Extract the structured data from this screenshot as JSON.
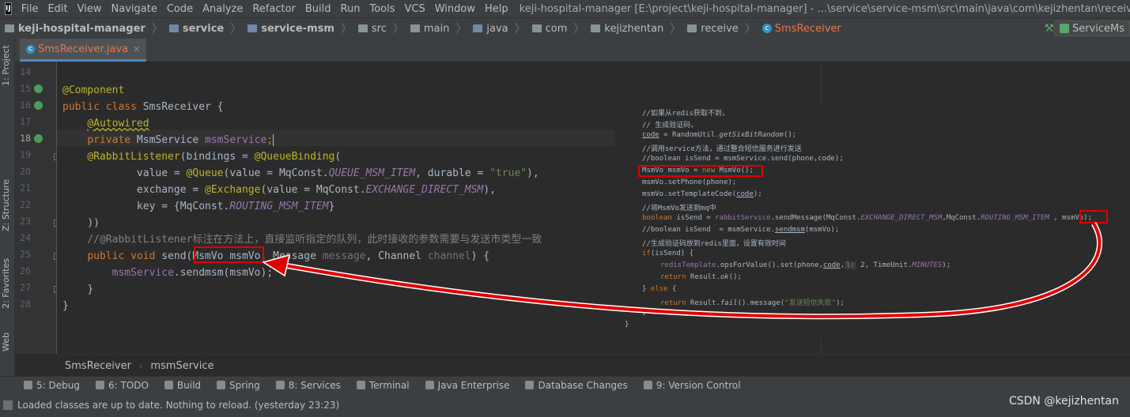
{
  "menubar": {
    "items": [
      "File",
      "Edit",
      "View",
      "Navigate",
      "Code",
      "Analyze",
      "Refactor",
      "Build",
      "Run",
      "Tools",
      "VCS",
      "Window",
      "Help"
    ],
    "window_title": "keji-hospital-manager [E:\\project\\keji-hospital-manager] - ...\\service\\service-msm\\src\\main\\java\\com\\kejizhentan\\receive\\SmsReceiver.java"
  },
  "navbar": {
    "crumbs": [
      "keji-hospital-manager",
      "service",
      "service-msm",
      "src",
      "main",
      "java",
      "com",
      "kejizhentan",
      "receive",
      "SmsReceiver"
    ],
    "run_config": "ServiceMs"
  },
  "left_tool_tabs": [
    "1: Project",
    "Z: Structure",
    "2: Favorites",
    "Web"
  ],
  "editor": {
    "tab_label": "SmsReceiver.java",
    "line_numbers": [
      "14",
      "15",
      "16",
      "17",
      "18",
      "19",
      "20",
      "21",
      "22",
      "23",
      "24",
      "25",
      "26",
      "27",
      "28"
    ],
    "current_line": "18",
    "code": {
      "l15": "@Component",
      "l16_kw": "public class",
      "l16_name": " SmsReceiver {",
      "l17": "@Autowired",
      "l18_kw": "private",
      "l18_type": " MsmService ",
      "l18_field": "msmService",
      "l18_end": ";",
      "l19_ann": "@RabbitListener",
      "l19_a": "(bindings = ",
      "l19_ann2": "@QueueBinding",
      "l19_b": "(",
      "l20_a": "value = ",
      "l20_ann": "@Queue",
      "l20_b": "(value = MqConst.",
      "l20_const": "QUEUE_MSM_ITEM",
      "l20_c": ", durable = ",
      "l20_str": "\"true\"",
      "l20_d": "),",
      "l21_a": "exchange = ",
      "l21_ann": "@Exchange",
      "l21_b": "(value = MqConst.",
      "l21_const": "EXCHANGE_DIRECT_MSM",
      "l21_c": "),",
      "l22_a": "key = {MqConst.",
      "l22_const": "ROUTING_MSM_ITEM",
      "l22_b": "}",
      "l23": "))",
      "l24": "//@RabbitListener标注在方法上，直接监听指定的队列，此时接收的参数需要与发送市类型一致",
      "l25_kw": "public void",
      "l25_a": " send(MsmVo msmVo, Message ",
      "l25_p1": "message",
      "l25_b": ", Channel ",
      "l25_p2": "channel",
      "l25_c": ") {",
      "l26_field": "msmService",
      "l26_a": ".sendmsm(msmVo);",
      "l27": "}",
      "l28": "}"
    }
  },
  "snippet": {
    "s1": "//如果从redis获取不到，",
    "s2": "// 生成验证码，",
    "s3_a": "code",
    "s3_b": " = RandomUtil.",
    "s3_c": "getSixBitRandom",
    "s3_d": "();",
    "s4": "//调用service方法，通过整合短信服务进行发送",
    "s5": "//boolean isSend = msmService.send(phone,code);",
    "s6_a": "MsmVo msmVo = ",
    "s6_kw": "new",
    "s6_b": " MsmVo();",
    "s7": "msmVo.setPhone(phone);",
    "s8_a": "msmVo.setTemplateCode(",
    "s8_b": "code",
    "s8_c": ");",
    "s9": "//将MsmVo发送到mq中",
    "s10_kw": "boolean",
    "s10_a": " isSend = ",
    "s10_fld": "rabbitService",
    "s10_b": ".sendMessage(MqConst.",
    "s10_c1": "EXCHANGE_DIRECT_MSM",
    "s10_c": ",MqConst.",
    "s10_c2": "ROUTING_MSM_ITEM",
    "s10_d": " , msmVo);",
    "s11_a": "//boolean isSend  = msmService.",
    "s11_b": "sendmsm",
    "s11_c": "(msmVo);",
    "s12": "//生成验证码放到redis里面，设置有效时间",
    "s13_kw": "if",
    "s13_a": "(isSend) {",
    "s14_fld": "redisTemplate",
    "s14_a": ".opsForValue().set(phone,",
    "s14_b": "code",
    "s14_c": ",",
    "s14_hint": "l:",
    "s14_d": " 2, TimeUnit.",
    "s14_e": "MINUTES",
    "s14_f": ");",
    "s15_kw": "return",
    "s15_a": " Result.",
    "s15_b": "ok",
    "s15_c": "();",
    "s16_a": "} ",
    "s16_kw": "else",
    "s16_b": " {",
    "s17_kw": "return",
    "s17_a": " Result.",
    "s17_b": "fail",
    "s17_c": "().message(",
    "s17_str": "\"发送短信失败\"",
    "s17_d": ");",
    "s18": "}",
    "s19": "}"
  },
  "code_crumbs": [
    "SmsReceiver",
    "msmService"
  ],
  "tool_windows": [
    "5: Debug",
    "6: TODO",
    "Build",
    "Spring",
    "8: Services",
    "Terminal",
    "Java Enterprise",
    "Database Changes",
    "9: Version Control"
  ],
  "status": {
    "message": "Loaded classes are up to date. Nothing to reload. (yesterday 23:23)",
    "watermark": "CSDN @kejizhentan"
  },
  "colors": {
    "annotation_red": "#e00000",
    "keyword": "#cc7832",
    "string": "#6a8759",
    "field": "#9876aa"
  }
}
